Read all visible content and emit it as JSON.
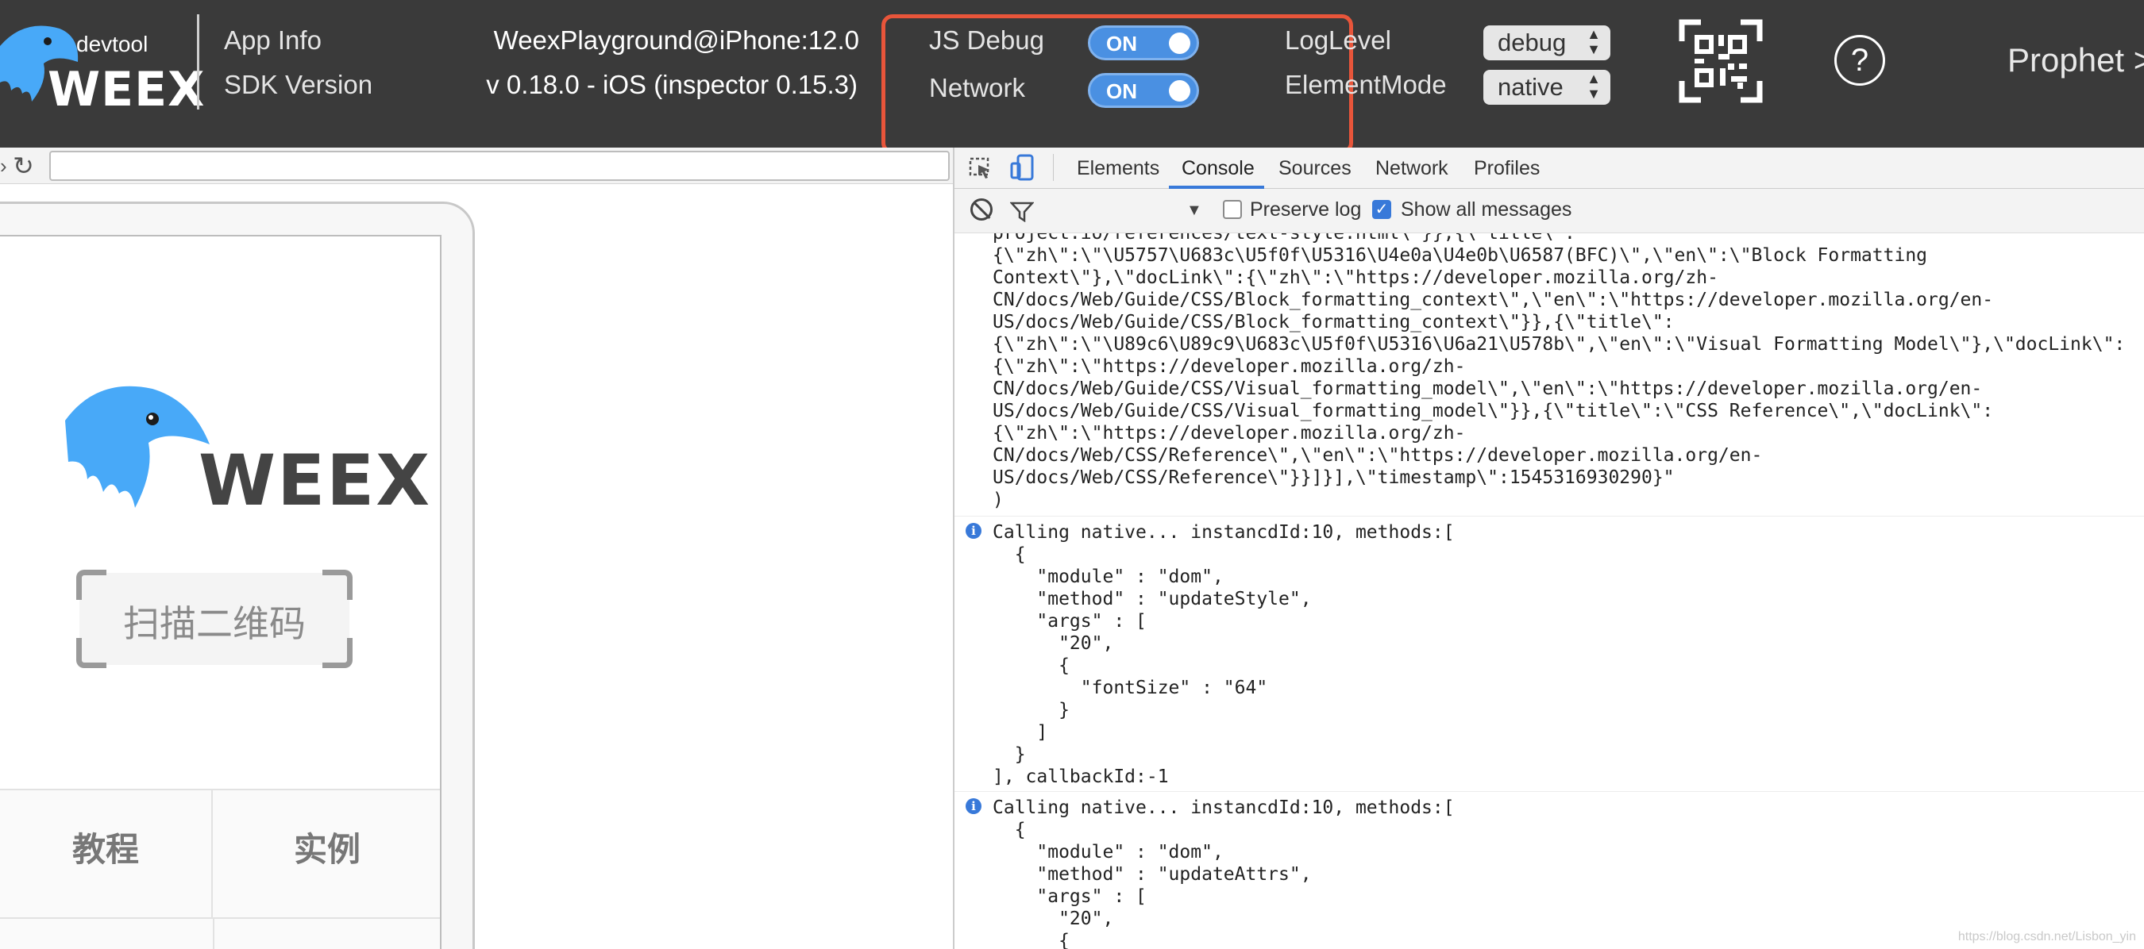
{
  "header": {
    "logo_devtool": "devtool",
    "logo_brand": "WEEX",
    "app_info_label": "App Info",
    "app_info_value": "WeexPlayground@iPhone:12.0",
    "sdk_version_label": "SDK Version",
    "sdk_version_value": "v 0.18.0 - iOS (inspector 0.15.3)",
    "js_debug_label": "JS Debug",
    "js_debug_state": "ON",
    "network_label": "Network",
    "network_state": "ON",
    "log_level_label": "LogLevel",
    "log_level_value": "debug",
    "element_mode_label": "ElementMode",
    "element_mode_value": "native",
    "help_glyph": "?",
    "prophet_label": "Prophet >",
    "accent_color": "#4a90e2",
    "highlight_color": "#e8553a"
  },
  "simulator": {
    "brand": "WEEX",
    "scan_button_label": "扫描二维码",
    "tab_tutorial": "教程",
    "tab_examples": "实例"
  },
  "devtools": {
    "tabs": [
      "Elements",
      "Console",
      "Sources",
      "Network",
      "Profiles"
    ],
    "active_tab": "Console",
    "preserve_log_label": "Preserve log",
    "preserve_log_checked": false,
    "show_all_label": "Show all messages",
    "show_all_checked": true,
    "messages": [
      {
        "icon": "none",
        "text": "project.io/references/text-style.html\\\"}},{\\\"title\\\":\n{\\\"zh\\\":\\\"\\U5757\\U683c\\U5f0f\\U5316\\U4e0a\\U4e0b\\U6587(BFC)\\\",\\\"en\\\":\\\"Block Formatting\nContext\\\"},\\\"docLink\\\":{\\\"zh\\\":\\\"https://developer.mozilla.org/zh-\nCN/docs/Web/Guide/CSS/Block_formatting_context\\\",\\\"en\\\":\\\"https://developer.mozilla.org/en-\nUS/docs/Web/Guide/CSS/Block_formatting_context\\\"}},{\\\"title\\\":\n{\\\"zh\\\":\\\"\\U89c6\\U89c9\\U683c\\U5f0f\\U5316\\U6a21\\U578b\\\",\\\"en\\\":\\\"Visual Formatting Model\\\"},\\\"docLink\\\":\n{\\\"zh\\\":\\\"https://developer.mozilla.org/zh-\nCN/docs/Web/Guide/CSS/Visual_formatting_model\\\",\\\"en\\\":\\\"https://developer.mozilla.org/en-\nUS/docs/Web/Guide/CSS/Visual_formatting_model\\\"}},{\\\"title\\\":\\\"CSS Reference\\\",\\\"docLink\\\":\n{\\\"zh\\\":\\\"https://developer.mozilla.org/zh-\nCN/docs/Web/CSS/Reference\\\",\\\"en\\\":\\\"https://developer.mozilla.org/en-\nUS/docs/Web/CSS/Reference\\\"}}]}],\\\"timestamp\\\":1545316930290}\"\n)"
      },
      {
        "icon": "info",
        "text": "Calling native... instancdId:10, methods:[\n  {\n    \"module\" : \"dom\",\n    \"method\" : \"updateStyle\",\n    \"args\" : [\n      \"20\",\n      {\n        \"fontSize\" : \"64\"\n      }\n    ]\n  }\n], callbackId:-1"
      },
      {
        "icon": "info",
        "text": "Calling native... instancdId:10, methods:[\n  {\n    \"module\" : \"dom\",\n    \"method\" : \"updateAttrs\",\n    \"args\" : [\n      \"20\",\n      {"
      }
    ],
    "watermark": "https://blog.csdn.net/Lisbon_yin"
  }
}
